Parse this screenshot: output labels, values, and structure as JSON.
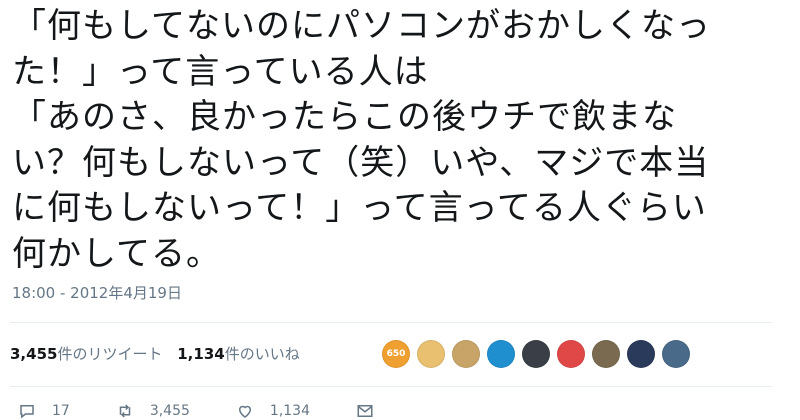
{
  "tweet": {
    "lines": [
      "「何もしてないのにパソコンがおかしくなっ",
      "た！」って言っている人は",
      "「あのさ、良かったらこの後ウチで飲まな",
      "い？何もしないって（笑）いや、マジで本当",
      "に何もしないって！」って言ってる人ぐらい",
      "何かしてる。"
    ],
    "timestamp": "18:00 - 2012年4月19日"
  },
  "stats": {
    "retweets_count": "3,455",
    "retweets_label": "件のリツイート",
    "likes_count": "1,134",
    "likes_label": "件のいいね"
  },
  "liker_avatars": [
    {
      "color": "#f0a030",
      "text": "650"
    },
    {
      "color": "#e8c070",
      "text": ""
    },
    {
      "color": "#c9a468",
      "text": ""
    },
    {
      "color": "#1f8fd0",
      "text": ""
    },
    {
      "color": "#3a3f47",
      "text": ""
    },
    {
      "color": "#e04848",
      "text": ""
    },
    {
      "color": "#7a6a50",
      "text": ""
    },
    {
      "color": "#2a3a5a",
      "text": ""
    },
    {
      "color": "#4a6a8a",
      "text": ""
    }
  ],
  "actions": {
    "reply_count": "17",
    "retweet_count": "3,455",
    "like_count": "1,134"
  },
  "icons": {
    "reply": "reply-icon",
    "retweet": "retweet-icon",
    "like": "heart-icon",
    "dm": "envelope-icon"
  }
}
